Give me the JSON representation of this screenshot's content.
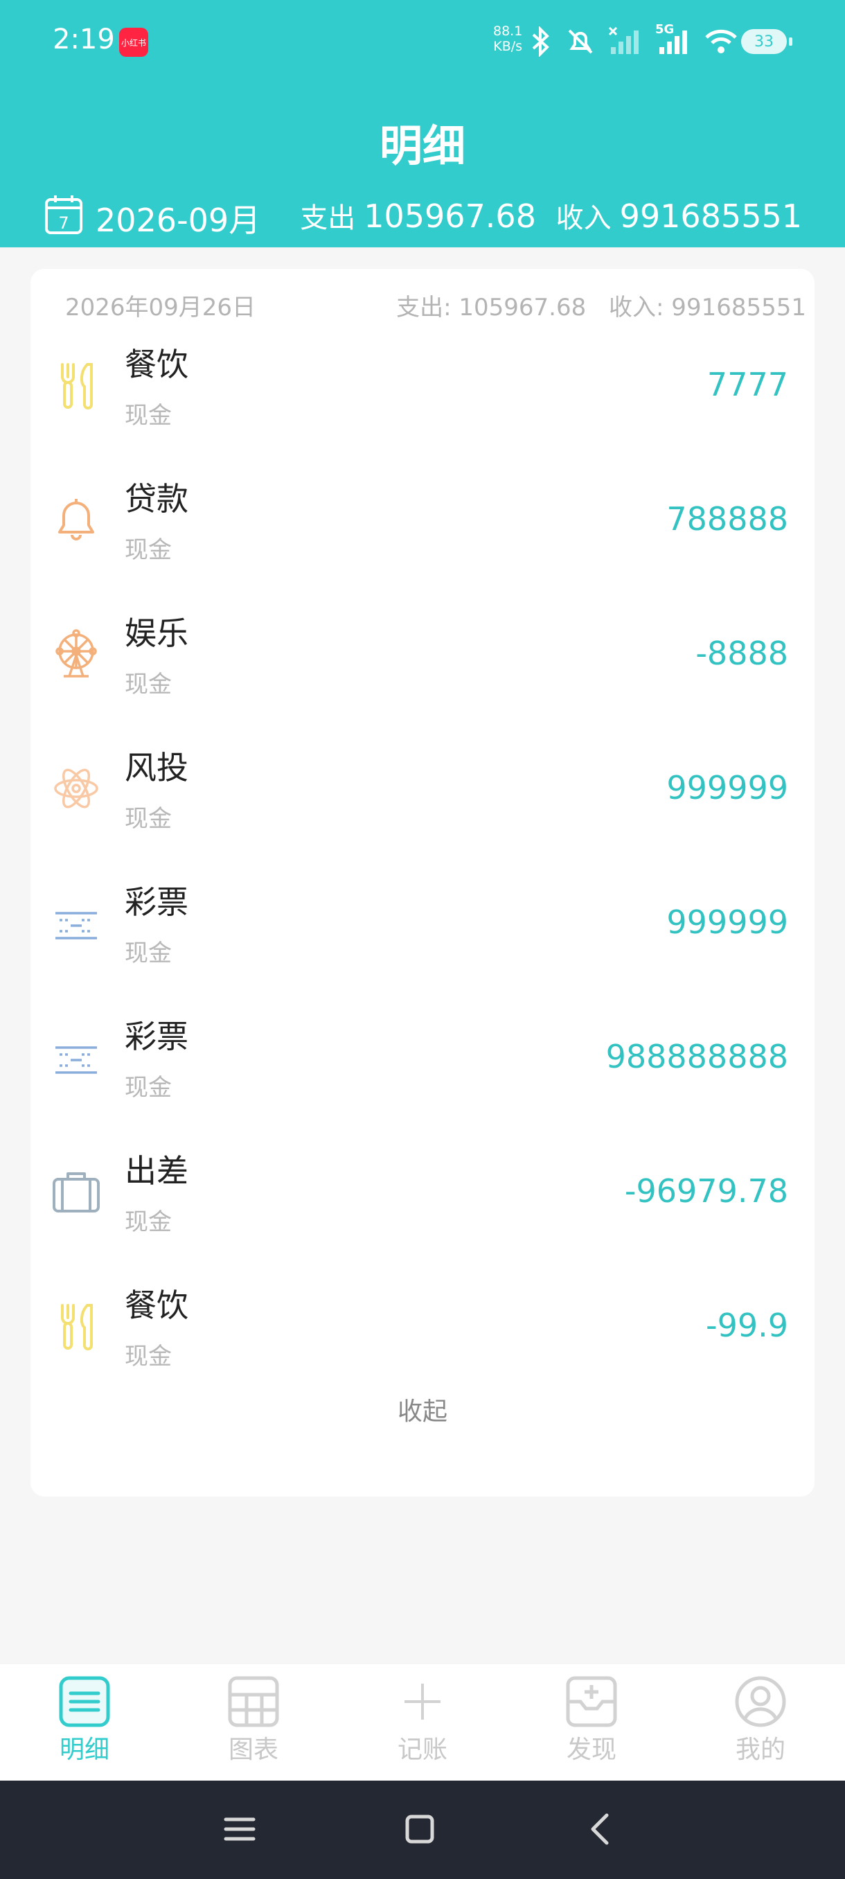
{
  "status_bar": {
    "time": "2:19",
    "app_badge": "小红书",
    "net_speed_value": "88.1",
    "net_speed_unit": "KB/s",
    "network": "5G",
    "battery": "33"
  },
  "header": {
    "title": "明细",
    "month": "2026-09月",
    "expense_label": "支出",
    "expense_value": "105967.68",
    "income_label": "收入",
    "income_value": "991685551"
  },
  "day_group": {
    "date": "2026年09月26日",
    "expense_text": "支出: 105967.68",
    "income_text": "收入: 991685551"
  },
  "transactions": [
    {
      "category": "餐饮",
      "account": "现金",
      "amount": "7777",
      "icon": "cutlery-icon"
    },
    {
      "category": "贷款",
      "account": "现金",
      "amount": "788888",
      "icon": "bell-icon"
    },
    {
      "category": "娱乐",
      "account": "现金",
      "amount": "-8888",
      "icon": "ferris-wheel-icon"
    },
    {
      "category": "风投",
      "account": "现金",
      "amount": "999999",
      "icon": "atom-icon"
    },
    {
      "category": "彩票",
      "account": "现金",
      "amount": "999999",
      "icon": "lottery-icon"
    },
    {
      "category": "彩票",
      "account": "现金",
      "amount": "988888888",
      "icon": "lottery-icon"
    },
    {
      "category": "出差",
      "account": "现金",
      "amount": "-96979.78",
      "icon": "suitcase-icon"
    },
    {
      "category": "餐饮",
      "account": "现金",
      "amount": "-99.9",
      "icon": "cutlery-icon"
    }
  ],
  "collapse_label": "收起",
  "bottom_nav": [
    {
      "label": "明细",
      "active": true,
      "icon": "list-icon"
    },
    {
      "label": "图表",
      "active": false,
      "icon": "chart-table-icon"
    },
    {
      "label": "记账",
      "active": false,
      "icon": "plus-icon"
    },
    {
      "label": "发现",
      "active": false,
      "icon": "discover-icon"
    },
    {
      "label": "我的",
      "active": false,
      "icon": "user-icon"
    }
  ],
  "colors": {
    "accent": "#33cccc",
    "amount": "#33c2c2",
    "system_nav": "#242833"
  }
}
